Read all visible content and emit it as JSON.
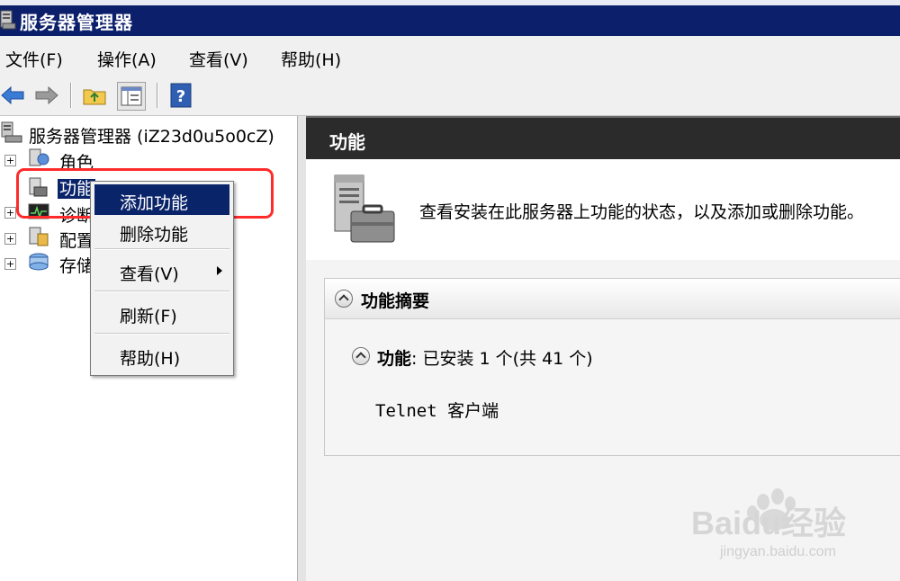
{
  "window": {
    "title": "服务器管理器"
  },
  "menubar": {
    "items": [
      "文件(F)",
      "操作(A)",
      "查看(V)",
      "帮助(H)"
    ]
  },
  "toolbar": {
    "buttons": [
      "back-arrow-icon",
      "forward-arrow-icon",
      "up-folder-icon",
      "show-hide-tree-icon",
      "help-icon"
    ]
  },
  "tree": {
    "root": "服务器管理器 (iZ23d0u5o0cZ)",
    "items": [
      {
        "label": "角色",
        "icon": "roles-icon",
        "expander": "+"
      },
      {
        "label": "功能",
        "icon": "features-icon",
        "expander": ""
      },
      {
        "label": "诊断",
        "icon": "diagnostics-icon",
        "expander": "+"
      },
      {
        "label": "配置",
        "icon": "configuration-icon",
        "expander": "+"
      },
      {
        "label": "存储",
        "icon": "storage-icon",
        "expander": "+"
      }
    ]
  },
  "context_menu": {
    "items": [
      {
        "label": "添加功能",
        "highlighted": true
      },
      {
        "label": "删除功能"
      },
      {
        "label": "查看(V)",
        "submenu": true
      },
      {
        "label": "刷新(F)"
      },
      {
        "label": "帮助(H)"
      }
    ]
  },
  "right_pane": {
    "header": "功能",
    "description": "查看安装在此服务器上功能的状态，以及添加或删除功能。",
    "summary": {
      "title": "功能摘要",
      "sub_label": "功能",
      "sub_value": ": 已安装 1 个(共 41 个)",
      "installed": [
        "Telnet 客户端"
      ]
    }
  },
  "watermark": {
    "text": "Baidu经验",
    "url": "jingyan.baidu.com"
  },
  "colors": {
    "titlebar": "#0c1f6b",
    "highlight": "#0a246a",
    "callout": "#ff2b2b",
    "pane_header": "#2b2b2b"
  }
}
